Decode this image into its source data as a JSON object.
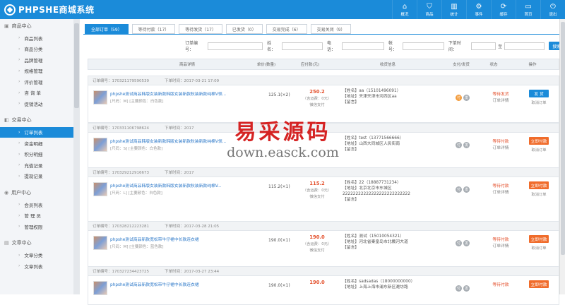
{
  "app": {
    "logo_text": "PHPSHE商城系统"
  },
  "topnav": [
    {
      "label": "概况",
      "icon": "home-icon",
      "glyph": "⌂"
    },
    {
      "label": "商品",
      "icon": "goods-icon",
      "glyph": "⛉"
    },
    {
      "label": "统计",
      "icon": "chart-icon",
      "glyph": "▥"
    },
    {
      "label": "事件",
      "icon": "gear-icon",
      "glyph": "⚙"
    },
    {
      "label": "缓存",
      "icon": "refresh-icon",
      "glyph": "⟳"
    },
    {
      "label": "首页",
      "icon": "monitor-icon",
      "glyph": "▭"
    },
    {
      "label": "退出",
      "icon": "power-icon",
      "glyph": "⏻"
    }
  ],
  "sidebar": {
    "groups": [
      {
        "title": "商品中心",
        "items": [
          "商品列表",
          "商品分类",
          "品牌管理",
          "规格管理",
          "评价管理",
          "咨 询 单",
          "促销活动"
        ]
      },
      {
        "title": "交易中心",
        "items": [
          "订单列表",
          "资金明细",
          "积分明细",
          "充值记录",
          "提现记录"
        ]
      },
      {
        "title": "用户中心",
        "items": [
          "会员列表",
          "管 理 员",
          "管理权限"
        ]
      },
      {
        "title": "文章中心",
        "items": [
          "文章分类",
          "文章列表"
        ]
      }
    ],
    "active_item": "订单列表"
  },
  "tabs": [
    "全部订单（59）",
    "等待付款（17）",
    "等待发货（17）",
    "已发货（0）",
    "交易完成（6）",
    "交易关闭（9）"
  ],
  "filter": {
    "order_no_label": "订单编号：",
    "name_label": "姓名：",
    "phone_label": "电话：",
    "account_label": "帐号：",
    "time_label": "下单时间：",
    "to_label": "至",
    "search_button": "搜索"
  },
  "table_headers": [
    "商品详情",
    "单价(数量)",
    "应付款(元)",
    "收货信息",
    "支付/发货",
    "状态",
    "操作"
  ],
  "orders": [
    {
      "no": "订单编号：170321179590539",
      "time": "下单时间：2017-03-21 17:09",
      "product": "phpshe测试商品韩版女装新款韩版女装新款秋装新款纯棉V领...",
      "spec": "[尺码：M] [主要颜色：白色款]",
      "qty": "125.1(×2)",
      "total": "250.2",
      "freight": "（含运费：0元）",
      "pay": "微信支付",
      "addr": [
        "【姓名】aa（15101496091）",
        "【地址】天津天津市河西区aa",
        "【留言】"
      ],
      "dot1": "付",
      "dot2": "发",
      "status1": "等待发货",
      "status2": "订单详情",
      "op_button": "发 货",
      "op_button_style": "ship",
      "op_link": "取消订单"
    },
    {
      "no": "订单编号：170331106798624",
      "time": "下单时间：2017",
      "product": "phpshe测试商品韩版女装新款韩版女装新款秋装新款纯棉V领...",
      "spec": "[尺码：S] [主要颜色：白色款]",
      "qty": "",
      "total": "",
      "freight": "",
      "pay": "",
      "addr": [
        "【姓名】test（13771566666）",
        "【地址】山西大同城区人民街南",
        "【留言】"
      ],
      "dot1": "付",
      "dot2": "发",
      "status1": "等待付款",
      "status2": "订单详情",
      "op_button": "立即付款",
      "op_button_style": "pay",
      "op_link": "取消订单"
    },
    {
      "no": "订单编号：170329212916673",
      "time": "下单时间：2017",
      "product": "phpshe测试商品韩版女装新款韩版女装新款秋装新款纯棉V...",
      "spec": "[尺码：L] [主要颜色：白色款]",
      "qty": "115.2(×1)",
      "total": "115.2",
      "freight": "（含运费：0元）",
      "pay": "微信支付",
      "addr": [
        "【姓名】22（18887731234）",
        "【地址】北京北京市东城区",
        "22222222222222222222222222",
        "【留言】"
      ],
      "dot1": "付",
      "dot2": "发",
      "status1": "等待付款",
      "status2": "订单详情",
      "op_button": "立即付款",
      "op_button_style": "pay",
      "op_link": "取消订单"
    },
    {
      "no": "订单编号：170328212223281",
      "time": "下单时间：2017-03-28 21:05",
      "product": "phpshe测试商品新款宽松带牛仔裙中长款连衣裙",
      "spec": "[尺码：M] [主要颜色：蓝色款]",
      "qty": "190.0(×1)",
      "total": "190.0",
      "freight": "（含运费：0元）",
      "pay": "微信支付",
      "addr": [
        "【姓名】测试（15010054321）",
        "【地址】河北省秦皇岛市北戴河大道",
        "【留言】"
      ],
      "dot1": "付",
      "dot2": "发",
      "status1": "等待付款",
      "status2": "订单详情",
      "op_button": "立即付款",
      "op_button_style": "pay",
      "op_link": "取消订单"
    },
    {
      "no": "订单编号：170327234423725",
      "time": "下单时间：2017-03-27 23:44",
      "product": "phpshe测试商品新款宽松带牛仔裙中长款连衣裙",
      "spec": "",
      "qty": "190.0(×1)",
      "total": "190.0",
      "freight": "",
      "pay": "",
      "addr": [
        "【姓名】sadsadas（18000000000）",
        "【地址】上海上海市浦东新区潍坊路"
      ],
      "dot1": "付",
      "dot2": "发",
      "status1": "等待付款",
      "status2": "",
      "op_button": "立即付款",
      "op_button_style": "pay",
      "op_link": ""
    }
  ],
  "watermark": {
    "cn": "易采源码",
    "url": "down.easck.com"
  }
}
